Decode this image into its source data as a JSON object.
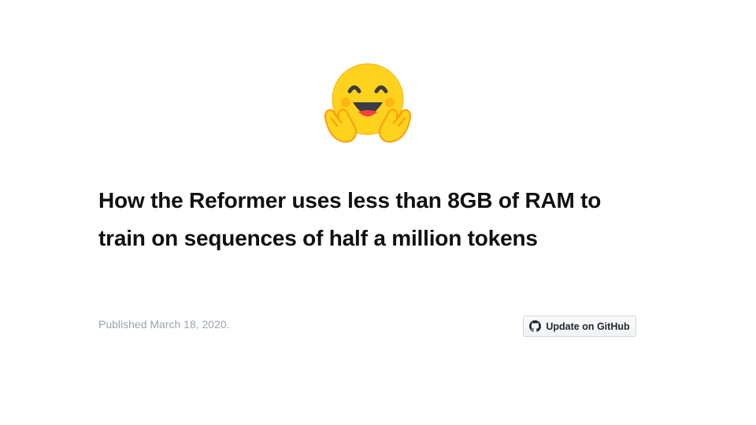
{
  "logo": {
    "icon": "hugging-face-emoji-icon"
  },
  "article": {
    "title_line_1": "How the Reformer uses less than 8GB of RAM to",
    "title_line_2": "train on sequences of half a million tokens",
    "published": "Published March 18, 2020."
  },
  "github_button": {
    "label": "Update on GitHub",
    "icon": "github-icon"
  }
}
